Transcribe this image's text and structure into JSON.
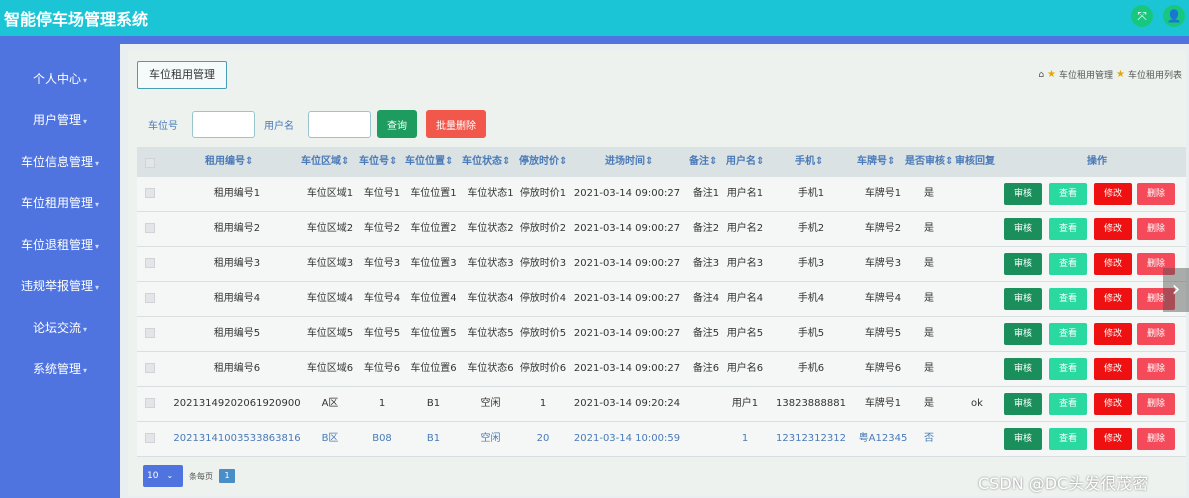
{
  "app": {
    "title": "智能停车场管理系统"
  },
  "header": {
    "icon_left": "⤧",
    "icon_right": "👤"
  },
  "sidebar": {
    "items": [
      {
        "label": "个人中心"
      },
      {
        "label": "用户管理"
      },
      {
        "label": "车位信息管理"
      },
      {
        "label": "车位租用管理"
      },
      {
        "label": "车位退租管理"
      },
      {
        "label": "违规举报管理"
      },
      {
        "label": "论坛交流"
      },
      {
        "label": "系统管理"
      }
    ]
  },
  "page": {
    "tab_label": "车位租用管理",
    "breadcrumb": [
      "车位租用管理",
      "车位租用列表"
    ]
  },
  "search": {
    "field1_label": "车位号",
    "field1_value": "",
    "field2_label": "用户名",
    "field2_value": "",
    "query_label": "查询",
    "batch_delete_label": "批量删除"
  },
  "table": {
    "headers": [
      "租用编号⇕",
      "车位区域⇕",
      "车位号⇕",
      "车位位置⇕",
      "车位状态⇕",
      "停放时价⇕",
      "进场时间⇕",
      "备注⇕",
      "用户名⇕",
      "手机⇕",
      "车牌号⇕",
      "是否审核⇕",
      "审核回复",
      "操作"
    ],
    "rows": [
      [
        "租用编号1",
        "车位区域1",
        "车位号1",
        "车位位置1",
        "车位状态1",
        "停放时价1",
        "2021-03-14 09:00:27",
        "备注1",
        "用户名1",
        "手机1",
        "车牌号1",
        "是",
        ""
      ],
      [
        "租用编号2",
        "车位区域2",
        "车位号2",
        "车位位置2",
        "车位状态2",
        "停放时价2",
        "2021-03-14 09:00:27",
        "备注2",
        "用户名2",
        "手机2",
        "车牌号2",
        "是",
        ""
      ],
      [
        "租用编号3",
        "车位区域3",
        "车位号3",
        "车位位置3",
        "车位状态3",
        "停放时价3",
        "2021-03-14 09:00:27",
        "备注3",
        "用户名3",
        "手机3",
        "车牌号3",
        "是",
        ""
      ],
      [
        "租用编号4",
        "车位区域4",
        "车位号4",
        "车位位置4",
        "车位状态4",
        "停放时价4",
        "2021-03-14 09:00:27",
        "备注4",
        "用户名4",
        "手机4",
        "车牌号4",
        "是",
        ""
      ],
      [
        "租用编号5",
        "车位区域5",
        "车位号5",
        "车位位置5",
        "车位状态5",
        "停放时价5",
        "2021-03-14 09:00:27",
        "备注5",
        "用户名5",
        "手机5",
        "车牌号5",
        "是",
        ""
      ],
      [
        "租用编号6",
        "车位区域6",
        "车位号6",
        "车位位置6",
        "车位状态6",
        "停放时价6",
        "2021-03-14 09:00:27",
        "备注6",
        "用户名6",
        "手机6",
        "车牌号6",
        "是",
        ""
      ],
      [
        "20213149202061920900",
        "A区",
        "1",
        "B1",
        "空闲",
        "1",
        "2021-03-14 09:20:24",
        "",
        "用户1",
        "13823888881",
        "车牌号1",
        "是",
        "ok"
      ],
      [
        "20213141003533863816",
        "B区",
        "B08",
        "B1",
        "空闲",
        "20",
        "2021-03-14 10:00:59",
        "",
        "1",
        "12312312312",
        "粤A12345",
        "否",
        ""
      ]
    ],
    "actions": {
      "audit": "审核",
      "view": "查看",
      "edit": "修改",
      "delete": "删除"
    }
  },
  "pagination": {
    "page_size": "10",
    "per_page_label": "条每页",
    "current_page": "1"
  },
  "overlay": {
    "next_arrow": "›",
    "watermark": "CSDN @DC头发很茂密"
  },
  "colors": {
    "topbar": "#1cc5d6",
    "sidebar": "#4f74e0",
    "audit": "#1a8f5c",
    "view": "#29d9a0",
    "edit": "#ef1111",
    "delete": "#f44a5a"
  }
}
